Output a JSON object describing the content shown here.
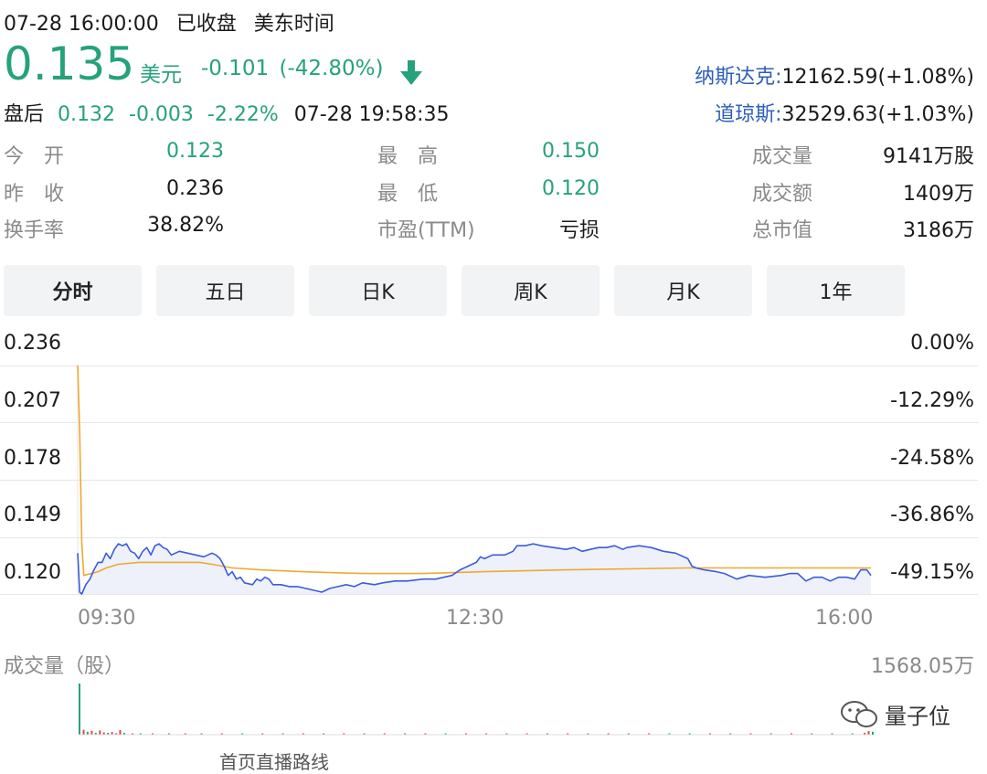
{
  "header": {
    "datetime": "07-28 16:00:00",
    "status": "已收盘",
    "timezone": "美东时间"
  },
  "quote": {
    "price": "0.135",
    "currency": "美元",
    "change": "-0.101",
    "change_pct": "(-42.80%)",
    "direction_icon": "arrow-down-icon",
    "up_color": "#26a27b"
  },
  "afterhours": {
    "label": "盘后",
    "price": "0.132",
    "change": "-0.003",
    "change_pct": "-2.22%",
    "time": "07-28 19:58:35"
  },
  "indices": [
    {
      "name": "纳斯达克:",
      "value": "12162.59(+1.08%)"
    },
    {
      "name": "道琼斯:",
      "value": "32529.63(+1.03%)"
    }
  ],
  "stats": {
    "open": {
      "label": "今　开",
      "value": "0.123"
    },
    "prev_close": {
      "label": "昨　收",
      "value": "0.236"
    },
    "turnover": {
      "label": "换手率",
      "value": "38.82%"
    },
    "high": {
      "label": "最　高",
      "value": "0.150"
    },
    "low": {
      "label": "最　低",
      "value": "0.120"
    },
    "pe": {
      "label": "市盈(TTM)",
      "value": "亏损"
    },
    "volume": {
      "label": "成交量",
      "value": "9141万股"
    },
    "amount": {
      "label": "成交额",
      "value": "1409万"
    },
    "market_cap": {
      "label": "总市值",
      "value": "3186万"
    }
  },
  "tabs": [
    {
      "label": "分时",
      "active": true
    },
    {
      "label": "五日",
      "active": false
    },
    {
      "label": "日K",
      "active": false
    },
    {
      "label": "周K",
      "active": false
    },
    {
      "label": "月K",
      "active": false
    },
    {
      "label": "1年",
      "active": false
    }
  ],
  "chart_data": {
    "type": "line",
    "y_ticks": [
      "0.236",
      "0.207",
      "0.178",
      "0.149",
      "0.120"
    ],
    "y_ticks_pct": [
      "0.00%",
      "-12.29%",
      "-24.58%",
      "-36.86%",
      "-49.15%"
    ],
    "ylim": [
      0.113,
      0.236
    ],
    "x_ticks": [
      "09:30",
      "12:30",
      "16:00"
    ],
    "x_range_minutes": [
      0,
      390
    ],
    "series": [
      {
        "role": "price",
        "color": "#3b5bdb",
        "points": [
          [
            0,
            0.135
          ],
          [
            1,
            0.114
          ],
          [
            2,
            0.113
          ],
          [
            4,
            0.118
          ],
          [
            6,
            0.121
          ],
          [
            8,
            0.126
          ],
          [
            10,
            0.13
          ],
          [
            12,
            0.13
          ],
          [
            14,
            0.135
          ],
          [
            16,
            0.132
          ],
          [
            18,
            0.137
          ],
          [
            20,
            0.14
          ],
          [
            22,
            0.139
          ],
          [
            24,
            0.14
          ],
          [
            26,
            0.136
          ],
          [
            28,
            0.135
          ],
          [
            30,
            0.132
          ],
          [
            32,
            0.136
          ],
          [
            34,
            0.138
          ],
          [
            36,
            0.134
          ],
          [
            38,
            0.139
          ],
          [
            40,
            0.14
          ],
          [
            42,
            0.138
          ],
          [
            44,
            0.137
          ],
          [
            46,
            0.134
          ],
          [
            50,
            0.136
          ],
          [
            54,
            0.135
          ],
          [
            58,
            0.134
          ],
          [
            62,
            0.133
          ],
          [
            66,
            0.135
          ],
          [
            68,
            0.134
          ],
          [
            70,
            0.132
          ],
          [
            72,
            0.128
          ],
          [
            74,
            0.123
          ],
          [
            76,
            0.125
          ],
          [
            78,
            0.121
          ],
          [
            80,
            0.122
          ],
          [
            82,
            0.119
          ],
          [
            86,
            0.118
          ],
          [
            88,
            0.121
          ],
          [
            90,
            0.12
          ],
          [
            92,
            0.122
          ],
          [
            94,
            0.121
          ],
          [
            96,
            0.118
          ],
          [
            100,
            0.118
          ],
          [
            104,
            0.117
          ],
          [
            108,
            0.117
          ],
          [
            112,
            0.116
          ],
          [
            116,
            0.115
          ],
          [
            120,
            0.114
          ],
          [
            124,
            0.116
          ],
          [
            128,
            0.117
          ],
          [
            132,
            0.118
          ],
          [
            136,
            0.117
          ],
          [
            140,
            0.119
          ],
          [
            146,
            0.118
          ],
          [
            150,
            0.119
          ],
          [
            156,
            0.12
          ],
          [
            162,
            0.12
          ],
          [
            170,
            0.121
          ],
          [
            176,
            0.121
          ],
          [
            180,
            0.122
          ],
          [
            184,
            0.123
          ],
          [
            188,
            0.126
          ],
          [
            192,
            0.128
          ],
          [
            196,
            0.13
          ],
          [
            198,
            0.133
          ],
          [
            200,
            0.132
          ],
          [
            204,
            0.134
          ],
          [
            210,
            0.134
          ],
          [
            214,
            0.136
          ],
          [
            216,
            0.139
          ],
          [
            220,
            0.139
          ],
          [
            224,
            0.14
          ],
          [
            228,
            0.139
          ],
          [
            234,
            0.138
          ],
          [
            240,
            0.137
          ],
          [
            244,
            0.138
          ],
          [
            248,
            0.136
          ],
          [
            252,
            0.137
          ],
          [
            256,
            0.138
          ],
          [
            260,
            0.138
          ],
          [
            264,
            0.139
          ],
          [
            268,
            0.137
          ],
          [
            270,
            0.138
          ],
          [
            276,
            0.139
          ],
          [
            282,
            0.138
          ],
          [
            288,
            0.136
          ],
          [
            294,
            0.135
          ],
          [
            300,
            0.132
          ],
          [
            302,
            0.128
          ],
          [
            304,
            0.127
          ],
          [
            308,
            0.126
          ],
          [
            314,
            0.125
          ],
          [
            318,
            0.124
          ],
          [
            324,
            0.121
          ],
          [
            330,
            0.123
          ],
          [
            338,
            0.122
          ],
          [
            346,
            0.123
          ],
          [
            350,
            0.124
          ],
          [
            354,
            0.124
          ],
          [
            358,
            0.12
          ],
          [
            362,
            0.122
          ],
          [
            366,
            0.122
          ],
          [
            370,
            0.12
          ],
          [
            374,
            0.122
          ],
          [
            378,
            0.122
          ],
          [
            382,
            0.121
          ],
          [
            385,
            0.126
          ],
          [
            388,
            0.126
          ],
          [
            390,
            0.123
          ]
        ]
      },
      {
        "role": "average",
        "color": "#f0a830",
        "points": [
          [
            0,
            0.236
          ],
          [
            1,
            0.2
          ],
          [
            2,
            0.14
          ],
          [
            3,
            0.123
          ],
          [
            10,
            0.125
          ],
          [
            14,
            0.127
          ],
          [
            20,
            0.129
          ],
          [
            30,
            0.13
          ],
          [
            60,
            0.13
          ],
          [
            66,
            0.129
          ],
          [
            76,
            0.127
          ],
          [
            90,
            0.126
          ],
          [
            110,
            0.125
          ],
          [
            140,
            0.124
          ],
          [
            170,
            0.124
          ],
          [
            200,
            0.125
          ],
          [
            240,
            0.126
          ],
          [
            300,
            0.127
          ],
          [
            350,
            0.127
          ],
          [
            390,
            0.127
          ]
        ]
      }
    ]
  },
  "volume": {
    "label": "成交量（股）",
    "max_label": "1568.05万",
    "max": 1568.05,
    "up_color": "#e84040",
    "down_color": "#26a27b",
    "bars": [
      {
        "t": 0,
        "v": 1568.05,
        "up": false
      },
      {
        "t": 2,
        "v": 150,
        "up": true
      },
      {
        "t": 4,
        "v": 90,
        "up": false
      },
      {
        "t": 6,
        "v": 120,
        "up": true
      },
      {
        "t": 8,
        "v": 60,
        "up": false
      },
      {
        "t": 10,
        "v": 130,
        "up": true
      },
      {
        "t": 12,
        "v": 70,
        "up": true
      },
      {
        "t": 14,
        "v": 55,
        "up": false
      },
      {
        "t": 16,
        "v": 80,
        "up": true
      },
      {
        "t": 18,
        "v": 45,
        "up": true
      },
      {
        "t": 20,
        "v": 140,
        "up": true
      },
      {
        "t": 22,
        "v": 60,
        "up": false
      },
      {
        "t": 26,
        "v": 35,
        "up": true
      },
      {
        "t": 30,
        "v": 40,
        "up": false
      },
      {
        "t": 36,
        "v": 30,
        "up": true
      },
      {
        "t": 44,
        "v": 25,
        "up": false
      },
      {
        "t": 52,
        "v": 22,
        "up": true
      },
      {
        "t": 60,
        "v": 28,
        "up": false
      },
      {
        "t": 70,
        "v": 20,
        "up": true
      },
      {
        "t": 80,
        "v": 18,
        "up": false
      },
      {
        "t": 90,
        "v": 16,
        "up": true
      },
      {
        "t": 100,
        "v": 14,
        "up": false
      },
      {
        "t": 110,
        "v": 18,
        "up": true
      },
      {
        "t": 120,
        "v": 15,
        "up": false
      },
      {
        "t": 130,
        "v": 20,
        "up": true
      },
      {
        "t": 140,
        "v": 16,
        "up": false
      },
      {
        "t": 150,
        "v": 18,
        "up": true
      },
      {
        "t": 160,
        "v": 14,
        "up": false
      },
      {
        "t": 170,
        "v": 22,
        "up": true
      },
      {
        "t": 180,
        "v": 15,
        "up": false
      },
      {
        "t": 190,
        "v": 35,
        "up": true
      },
      {
        "t": 200,
        "v": 25,
        "up": true
      },
      {
        "t": 210,
        "v": 18,
        "up": false
      },
      {
        "t": 220,
        "v": 20,
        "up": true
      },
      {
        "t": 230,
        "v": 16,
        "up": false
      },
      {
        "t": 240,
        "v": 14,
        "up": true
      },
      {
        "t": 250,
        "v": 18,
        "up": false
      },
      {
        "t": 260,
        "v": 22,
        "up": true
      },
      {
        "t": 270,
        "v": 16,
        "up": false
      },
      {
        "t": 280,
        "v": 20,
        "up": true
      },
      {
        "t": 290,
        "v": 18,
        "up": false
      },
      {
        "t": 300,
        "v": 40,
        "up": false
      },
      {
        "t": 310,
        "v": 20,
        "up": true
      },
      {
        "t": 320,
        "v": 16,
        "up": false
      },
      {
        "t": 330,
        "v": 18,
        "up": true
      },
      {
        "t": 340,
        "v": 14,
        "up": false
      },
      {
        "t": 350,
        "v": 16,
        "up": true
      },
      {
        "t": 360,
        "v": 20,
        "up": false
      },
      {
        "t": 370,
        "v": 18,
        "up": true
      },
      {
        "t": 380,
        "v": 30,
        "up": false
      },
      {
        "t": 386,
        "v": 60,
        "up": true
      },
      {
        "t": 388,
        "v": 110,
        "up": true
      },
      {
        "t": 390,
        "v": 90,
        "up": false
      }
    ]
  },
  "watermark": {
    "text": "量子位",
    "icon": "wechat-icon"
  },
  "footer_partial": "首页直播路线"
}
